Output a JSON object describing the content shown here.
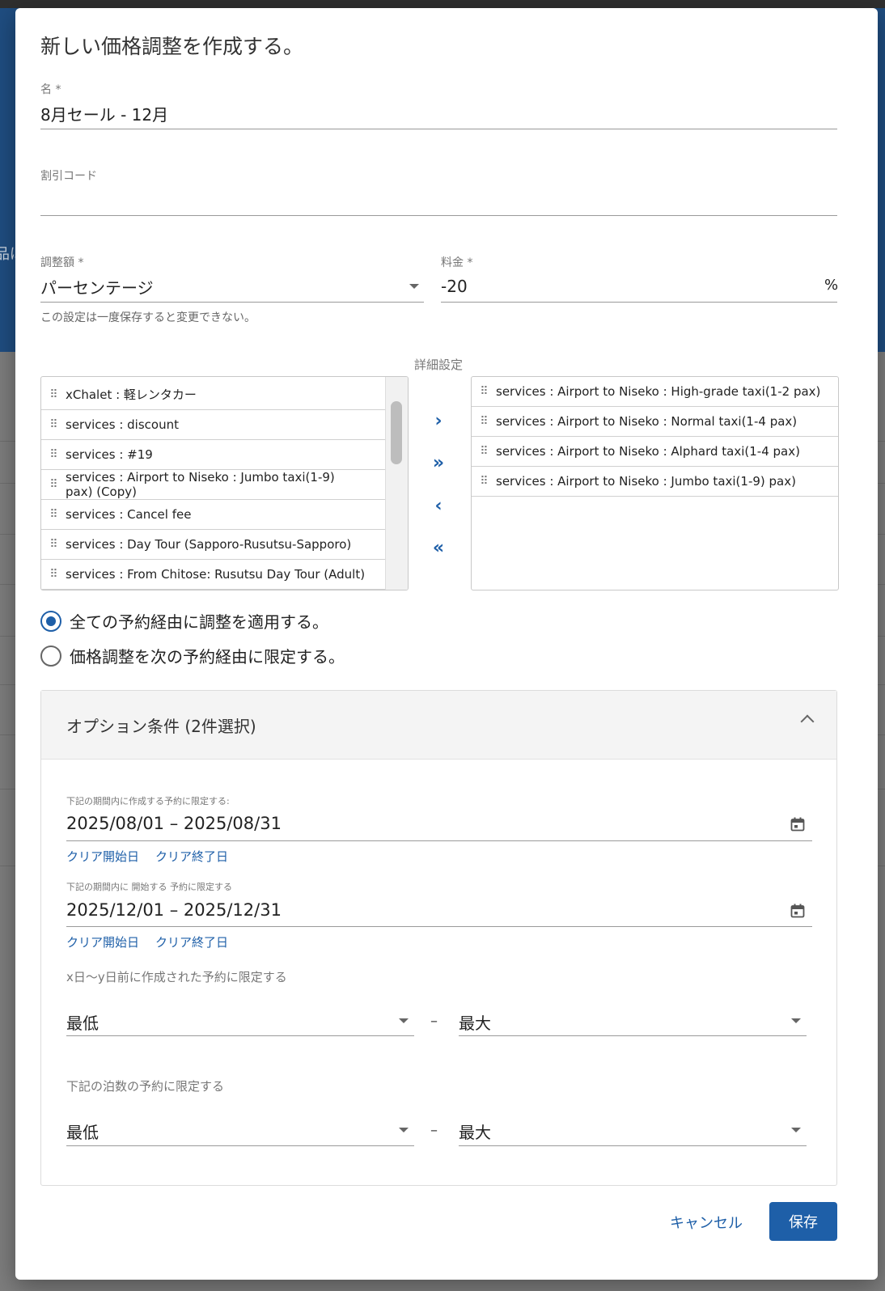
{
  "dialog": {
    "title": "新しい価格調整を作成する。"
  },
  "name_field": {
    "label": "名 *",
    "value": "8月セール - 12月"
  },
  "discount_code": {
    "label": "割引コード",
    "value": ""
  },
  "adjustment_type": {
    "label": "調整額 *",
    "value": "パーセンテージ",
    "hint": "この設定は一度保存すると変更できない。"
  },
  "rate": {
    "label": "料金 *",
    "value": "-20",
    "suffix": "%"
  },
  "transfer": {
    "title": "詳細設定",
    "available": [
      "xChalet : 軽レンタカー",
      "services : discount",
      "services : #19",
      "services : Airport to Niseko : Jumbo taxi(1-9) pax) (Copy)",
      "services : Cancel fee",
      "services : Day Tour (Sapporo-Rusutsu-Sapporo)",
      "services : From Chitose: Rusutsu Day Tour (Adult)"
    ],
    "selected": [
      "services : Airport to Niseko : High-grade taxi(1-2 pax)",
      "services : Airport to Niseko : Normal taxi(1-4 pax)",
      "services : Airport to Niseko : Alphard taxi(1-4 pax)",
      "services : Airport to Niseko : Jumbo taxi(1-9) pax)"
    ],
    "buttons": {
      "move_right": "›",
      "move_all_right": "»",
      "move_left": "‹",
      "move_all_left": "«"
    }
  },
  "channel_options": {
    "all": "全ての予約経由に調整を適用する。",
    "limited": "価格調整を次の予約経由に限定する。",
    "selected": "all"
  },
  "options_panel": {
    "title": "オプション条件 (2件選択)",
    "created_range": {
      "label": "下記の期間内に作成する予約に限定する:",
      "value": "2025/08/01 – 2025/08/31",
      "clear_start": "クリア開始日",
      "clear_end": "クリア終了日"
    },
    "start_range": {
      "label": "下記の期間内に 開始する 予約に限定する",
      "value": "2025/12/01 – 2025/12/31",
      "clear_start": "クリア開始日",
      "clear_end": "クリア終了日"
    },
    "days_before": {
      "label": "x日〜y日前に作成された予約に限定する",
      "min": "最低",
      "max": "最大",
      "sep": "–"
    },
    "nights": {
      "label": "下記の泊数の予約に限定する",
      "min": "最低",
      "max": "最大",
      "sep": "–"
    }
  },
  "footer": {
    "cancel": "キャンセル",
    "save": "保存"
  },
  "background": {
    "fragment": "品は"
  },
  "colors": {
    "primary": "#1e5fa8",
    "backdrop_blue": "#1f4d80"
  }
}
